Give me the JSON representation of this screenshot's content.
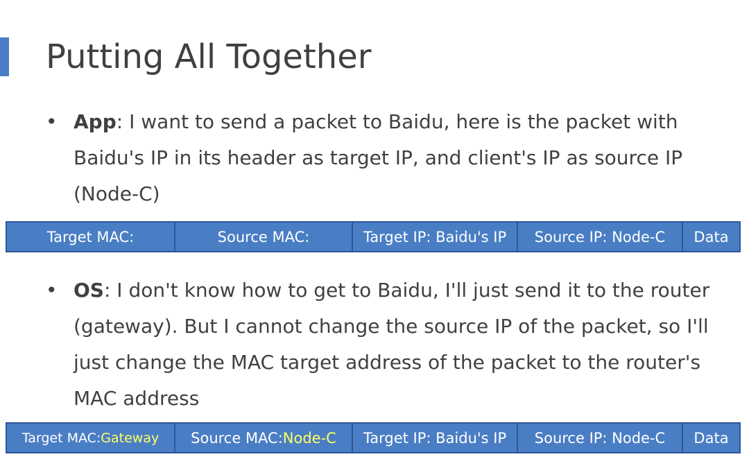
{
  "slide": {
    "title": "Putting All Together"
  },
  "bullets": [
    {
      "bullet_char": "•",
      "label": "App",
      "text": ": I want to send a packet to Baidu, here is the packet with Baidu's IP in its header as target IP, and client's IP as source IP (Node-C)"
    },
    {
      "bullet_char": "•",
      "label": "OS",
      "text": ": I don't know how to get to Baidu, I'll just send it to the router (gateway). But I cannot change the source IP of the packet, so I'll just change the MAC target address of the packet to the router's MAC address"
    }
  ],
  "packets": [
    {
      "target_mac_label": "Target MAC:",
      "target_mac_value": "",
      "source_mac_label": "Source MAC:",
      "source_mac_value": "",
      "target_ip": "Target IP: Baidu's IP",
      "source_ip": "Source IP: Node-C",
      "data": "Data"
    },
    {
      "target_mac_label": "Target MAC: ",
      "target_mac_value": "Gateway",
      "source_mac_label": "Source MAC: ",
      "source_mac_value": "Node-C",
      "target_ip": "Target IP: Baidu's IP",
      "source_ip": "Source IP: Node-C",
      "data": "Data"
    }
  ],
  "colors": {
    "accent": "#4a7ec4",
    "border": "#2f5597",
    "highlight": "#ffff66",
    "text": "#404040"
  }
}
